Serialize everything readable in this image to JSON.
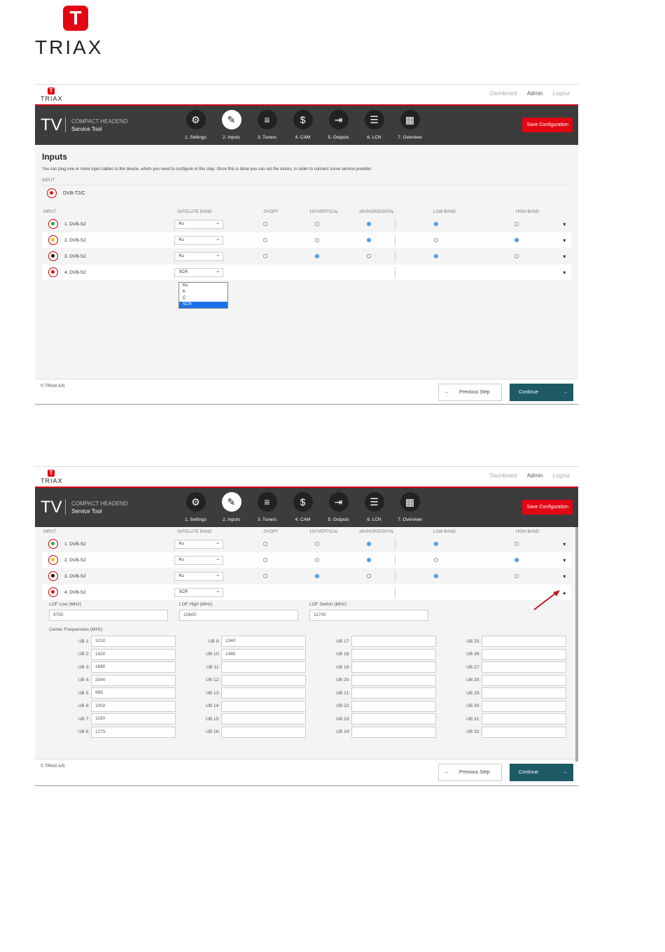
{
  "logo": {
    "letter": "T",
    "word": "TRIAX"
  },
  "app": {
    "mini_logo_letter": "T",
    "mini_logo_word": "TRIAX",
    "nav": [
      "Dashboard",
      "Admin",
      "Logout"
    ],
    "tv": "TV",
    "product_line1": "COMPACT HEADEND",
    "product_line2": "Service Tool",
    "steps": [
      "1. Settings",
      "2. Inputs",
      "3. Tuners",
      "4. CAM",
      "5. Outputs",
      "6. LCN",
      "7. Overview"
    ],
    "save_label": "Save Configuration",
    "copyright": "© TRIAX A/S",
    "prev_label": "Previous Step",
    "continue_label": "Continue"
  },
  "screen1": {
    "title": "Inputs",
    "description": "You can plug one or more input cables to the device, which you need to configure in this step. Once this is done you can set the tuners, in order to connect some service provider.",
    "input_label": "INPUT",
    "terrestrial": "DVB-T2/C",
    "dropdown_options": [
      "Ku",
      "K",
      "C",
      "SCR"
    ],
    "dropdown_selected": "SCR"
  },
  "table": {
    "headers": [
      "INPUT",
      "SATELLITE BAND",
      "0V/OFF",
      "13V/VERTICAL",
      "18V/HORIZONTAL",
      "LOW BAND",
      "HIGH BAND"
    ],
    "rows": [
      {
        "name": "1. DVB-S2",
        "band": "Ku",
        "color": "#22aa33",
        "sel_pol": "18V/HORIZONTAL",
        "sel_band": "LOW BAND"
      },
      {
        "name": "2. DVB-S2",
        "band": "Ku",
        "color": "#e0c800",
        "sel_pol": "18V/HORIZONTAL",
        "sel_band": "HIGH BAND"
      },
      {
        "name": "3. DVB-S2",
        "band": "Ku",
        "color": "#111111",
        "sel_pol": "13V/VERTICAL",
        "sel_band": "LOW BAND"
      },
      {
        "name": "4. DVB-S2",
        "band": "SCR",
        "color": "#dd1111"
      }
    ]
  },
  "screen2": {
    "lof_low_label": "LOF Low (MHz)",
    "lof_low": "9750",
    "lof_high_label": "LOF High (MHz)",
    "lof_high": "10600",
    "lof_switch_label": "LOF Switch (MHz)",
    "lof_switch": "11700",
    "cf_label": "Center Frequencies (MHz)",
    "ub": [
      [
        "UB 1:",
        "1210"
      ],
      [
        "UB 9:",
        "1340"
      ],
      [
        "UB 17:",
        ""
      ],
      [
        "UB 25:",
        ""
      ],
      [
        "UB 2:",
        "1420"
      ],
      [
        "UB 10:",
        "1485"
      ],
      [
        "UB 18:",
        ""
      ],
      [
        "UB 26:",
        ""
      ],
      [
        "UB 3:",
        "1680"
      ],
      [
        "UB 11:",
        ""
      ],
      [
        "UB 19:",
        ""
      ],
      [
        "UB 27:",
        ""
      ],
      [
        "UB 4:",
        "2040"
      ],
      [
        "UB 12:",
        ""
      ],
      [
        "UB 20:",
        ""
      ],
      [
        "UB 28:",
        ""
      ],
      [
        "UB 5:",
        "985"
      ],
      [
        "UB 13:",
        ""
      ],
      [
        "UB 21:",
        ""
      ],
      [
        "UB 29:",
        ""
      ],
      [
        "UB 6:",
        "1050"
      ],
      [
        "UB 14:",
        ""
      ],
      [
        "UB 22:",
        ""
      ],
      [
        "UB 30:",
        ""
      ],
      [
        "UB 7:",
        "1150"
      ],
      [
        "UB 15:",
        ""
      ],
      [
        "UB 23:",
        ""
      ],
      [
        "UB 31:",
        ""
      ],
      [
        "UB 8:",
        "1275"
      ],
      [
        "UB 16:",
        ""
      ],
      [
        "UB 24:",
        ""
      ],
      [
        "UB 32:",
        ""
      ]
    ]
  },
  "colors": {
    "brand_red": "#e30613",
    "header_bg": "#3c3c3c",
    "continue_bg": "#1d5a66",
    "radio_blue": "#1a73e8"
  },
  "icons": [
    "gear-icon",
    "plug-icon",
    "sliders-icon",
    "dollar-card-icon",
    "exit-icon",
    "list-icon",
    "grid-icon"
  ]
}
